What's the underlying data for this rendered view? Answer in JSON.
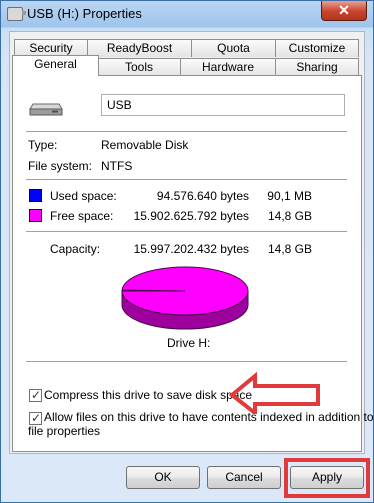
{
  "window": {
    "title": "USB (H:) Properties",
    "close_label": "✕"
  },
  "tabs": {
    "row1": [
      "Security",
      "ReadyBoost",
      "Quota",
      "Customize"
    ],
    "row2": [
      "General",
      "Tools",
      "Hardware",
      "Sharing"
    ],
    "active": "General"
  },
  "general": {
    "drive_name": "USB",
    "type_label": "Type:",
    "type_value": "Removable Disk",
    "fs_label": "File system:",
    "fs_value": "NTFS",
    "used": {
      "label": "Used space:",
      "bytes": "94.576.640 bytes",
      "size": "90,1 MB",
      "color": "#0000ff"
    },
    "free": {
      "label": "Free space:",
      "bytes": "15.902.625.792 bytes",
      "size": "14,8 GB",
      "color": "#ff00ff"
    },
    "capacity": {
      "label": "Capacity:",
      "bytes": "15.997.202.432 bytes",
      "size": "14,8 GB"
    },
    "drive_caption": "Drive H:",
    "compress_label": "Compress this drive to save disk space",
    "compress_checked": true,
    "index_label_line1": "Allow files on this drive to have contents indexed in addition to",
    "index_label_line2": "file properties",
    "index_checked": true
  },
  "chart_data": {
    "type": "pie",
    "categories": [
      "Used space",
      "Free space"
    ],
    "values": [
      94576640,
      15902625792
    ],
    "colors": [
      "#0000ff",
      "#ff00ff"
    ]
  },
  "buttons": {
    "ok": "OK",
    "cancel": "Cancel",
    "apply": "Apply"
  },
  "annotations": {
    "highlight_color": "#e03a3a"
  }
}
